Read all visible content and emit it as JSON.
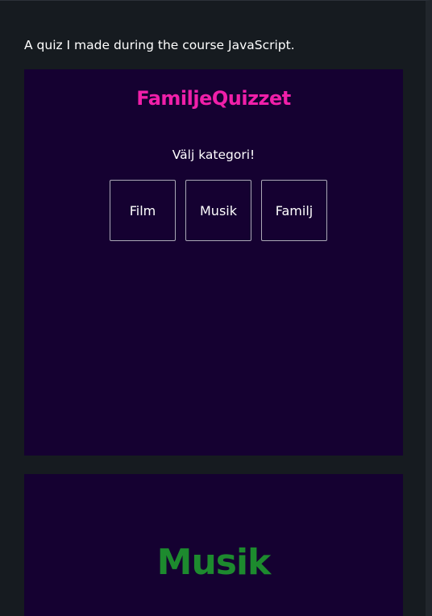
{
  "intro_text": "A quiz I made during the course JavaScript.",
  "quiz": {
    "title": "FamiljeQuizzet",
    "prompt": "Välj kategori!",
    "categories": [
      "Film",
      "Musik",
      "Familj"
    ]
  },
  "second_screenshot": {
    "title": "Musik"
  },
  "colors": {
    "page_background": "#161b20",
    "quiz_background": "#150131",
    "quiz_title": "#f01fa9",
    "musik_title": "#1d8a2e",
    "button_border": "#aaa8b6"
  }
}
